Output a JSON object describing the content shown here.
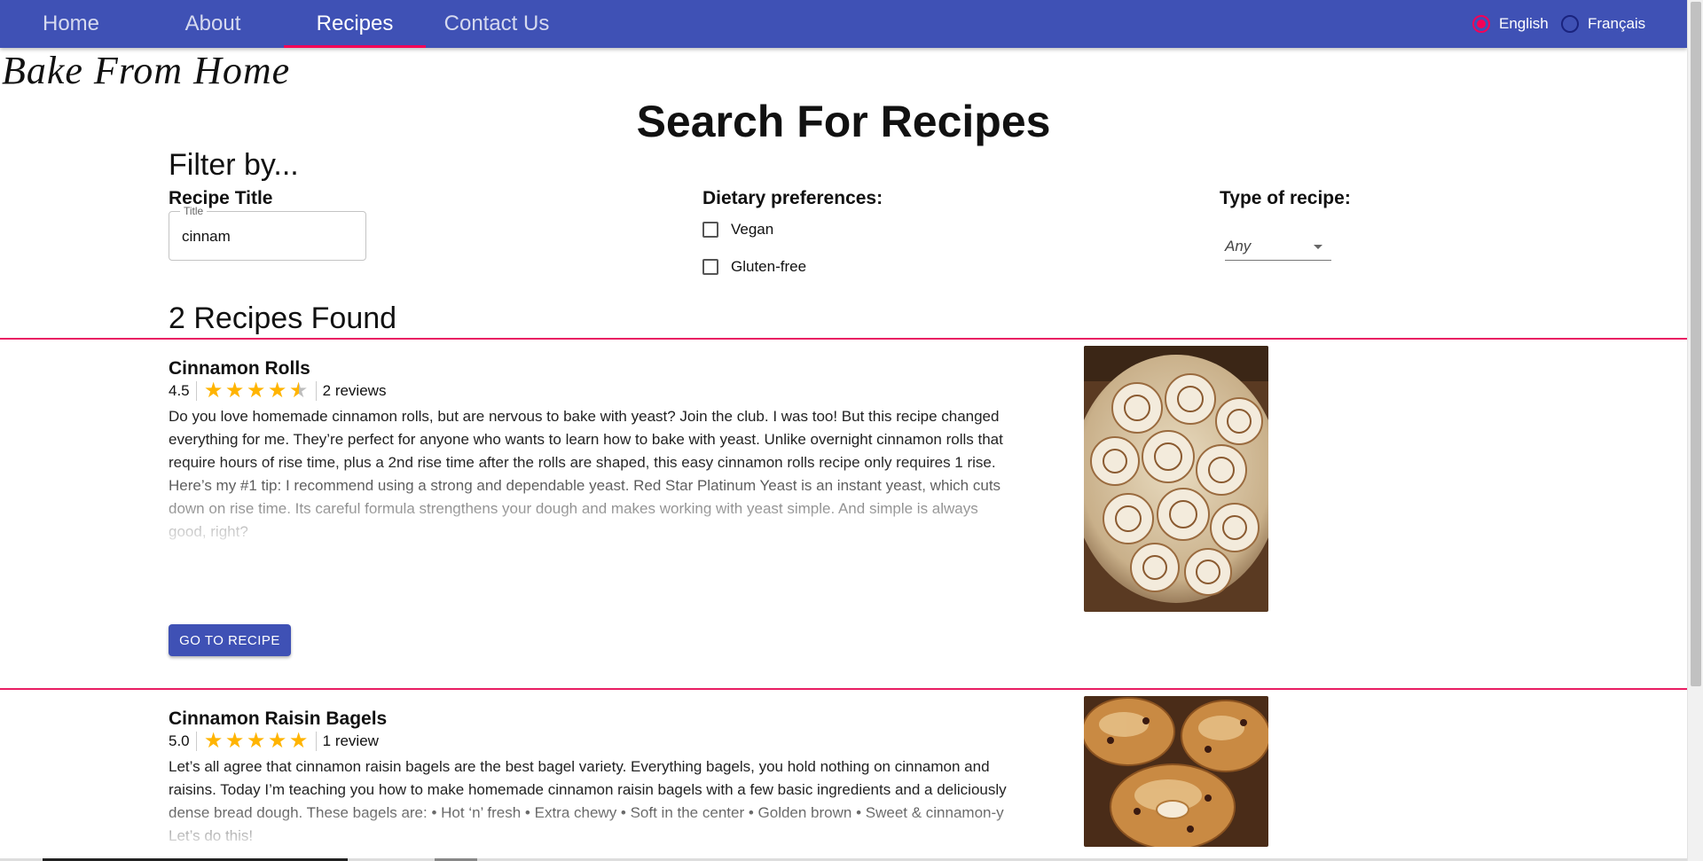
{
  "nav": {
    "tabs": [
      {
        "label": "Home",
        "active": false
      },
      {
        "label": "About",
        "active": false
      },
      {
        "label": "Recipes",
        "active": true
      },
      {
        "label": "Contact Us",
        "active": false
      }
    ],
    "languages": [
      {
        "label": "English",
        "selected": true
      },
      {
        "label": "Français",
        "selected": false
      }
    ]
  },
  "brand": {
    "logo_text": "Bake From Home"
  },
  "page": {
    "title": "Search For Recipes"
  },
  "filters": {
    "heading": "Filter by...",
    "recipe_title": {
      "label": "Recipe Title",
      "field_label": "Title",
      "value": "cinnam"
    },
    "dietary": {
      "label": "Dietary preferences:",
      "options": [
        {
          "label": "Vegan",
          "checked": false
        },
        {
          "label": "Gluten-free",
          "checked": false
        }
      ]
    },
    "type": {
      "label": "Type of recipe:",
      "selected": "Any"
    }
  },
  "results": {
    "count_text": "2 Recipes Found",
    "items": [
      {
        "title": "Cinnamon Rolls",
        "rating": "4.5",
        "rating_value": 4.5,
        "reviews": "2 reviews",
        "description": "Do you love homemade cinnamon rolls, but are nervous to bake with yeast? Join the club. I was too! But this recipe changed everything for me. They’re perfect for anyone who wants to learn how to bake with yeast. Unlike overnight cinnamon rolls that require hours of rise time, plus a 2nd rise time after the rolls are shaped, this easy cinnamon rolls recipe only requires 1 rise. Here’s my #1 tip: I recommend using a strong and dependable yeast. Red Star Platinum Yeast is an instant yeast, which cuts down on rise time. Its careful formula strengthens your dough and makes working with yeast simple. And simple is always good, right?",
        "button_label": "GO TO RECIPE"
      },
      {
        "title": "Cinnamon Raisin Bagels",
        "rating": "5.0",
        "rating_value": 5,
        "reviews": "1 review",
        "description": "Let’s all agree that cinnamon raisin bagels are the best bagel variety. Everything bagels, you hold nothing on cinnamon and raisins. Today I’m teaching you how to make homemade cinnamon raisin bagels with a few basic ingredients and a deliciously dense bread dough. These bagels are: • Hot ‘n’ fresh • Extra chewy • Soft in the center • Golden brown • Sweet & cinnamon-y Let’s do this!"
      }
    ]
  },
  "colors": {
    "primary": "#3f51b5",
    "accent": "#f50057",
    "divider": "#e91e63",
    "star": "#ffb400"
  }
}
